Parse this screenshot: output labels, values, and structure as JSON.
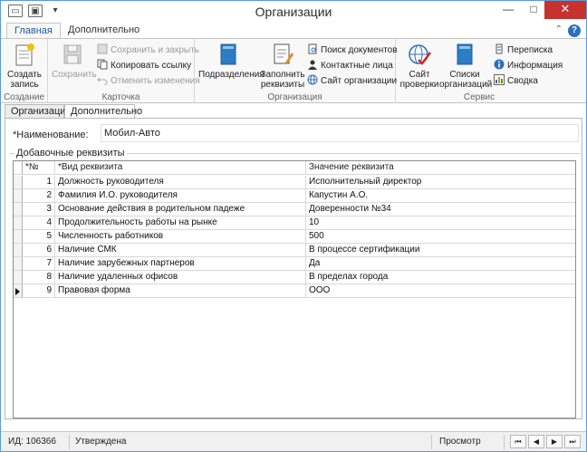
{
  "window": {
    "title": "Организации",
    "quick_access": [
      "save-quick-icon",
      "image-quick-icon",
      "customize-quick-icon"
    ],
    "controls": {
      "minimize": "—",
      "maximize": "□",
      "close": "✕"
    }
  },
  "ribbon": {
    "tabs": [
      {
        "label": "Главная",
        "active": true
      },
      {
        "label": "Дополнительно",
        "active": false
      }
    ],
    "help": "?",
    "groups": {
      "create": {
        "label": "Создание",
        "create_record": "Создать запись"
      },
      "card": {
        "label": "Карточка",
        "save": "Сохранить",
        "save_close": "Сохранить и закрыть",
        "copy_link": "Копировать ссылку",
        "undo": "Отменить изменения"
      },
      "org": {
        "label": "Организация",
        "subdivisions": "Подразделения",
        "fill_details": "Заполнить реквизиты",
        "doc_search": "Поиск документов",
        "contacts": "Контактные лица",
        "org_site": "Сайт организации"
      },
      "service": {
        "label": "Сервис",
        "check_site": "Сайт проверки",
        "org_lists": "Списки организаций",
        "correspondence": "Переписка",
        "information": "Информация",
        "summary": "Сводка"
      }
    }
  },
  "content_tabs": [
    {
      "label": "Организация",
      "active": false
    },
    {
      "label": "Дополнительно",
      "active": true
    }
  ],
  "form": {
    "name_label": "*Наименование:",
    "name_value": "Мобил-Авто",
    "extra_legend": "Добавочные реквизиты"
  },
  "grid": {
    "headers": {
      "num": "*№",
      "type": "*Вид реквизита",
      "value": "Значение реквизита"
    },
    "current_row_index": 8,
    "rows": [
      {
        "num": "1",
        "type": "Должность руководителя",
        "value": "Исполнительный директор"
      },
      {
        "num": "2",
        "type": "Фамилия И.О. руководителя",
        "value": "Капустин А.О."
      },
      {
        "num": "3",
        "type": "Основание действия в родительном падеже",
        "value": "Доверенности №34"
      },
      {
        "num": "4",
        "type": "Продолжительность работы на рынке",
        "value": "10"
      },
      {
        "num": "5",
        "type": "Численность работников",
        "value": "500"
      },
      {
        "num": "6",
        "type": "Наличие СМК",
        "value": "В процессе сертификации"
      },
      {
        "num": "7",
        "type": "Наличие зарубежных партнеров",
        "value": "Да"
      },
      {
        "num": "8",
        "type": "Наличие удаленных офисов",
        "value": "В пределах города"
      },
      {
        "num": "9",
        "type": "Правовая форма",
        "value": "ООО"
      }
    ]
  },
  "status": {
    "id": "ИД: 106366",
    "state": "Утверждена",
    "mode": "Просмотр",
    "nav": {
      "first": "⏮",
      "prev": "◀",
      "next": "▶",
      "last": "⏭"
    }
  }
}
